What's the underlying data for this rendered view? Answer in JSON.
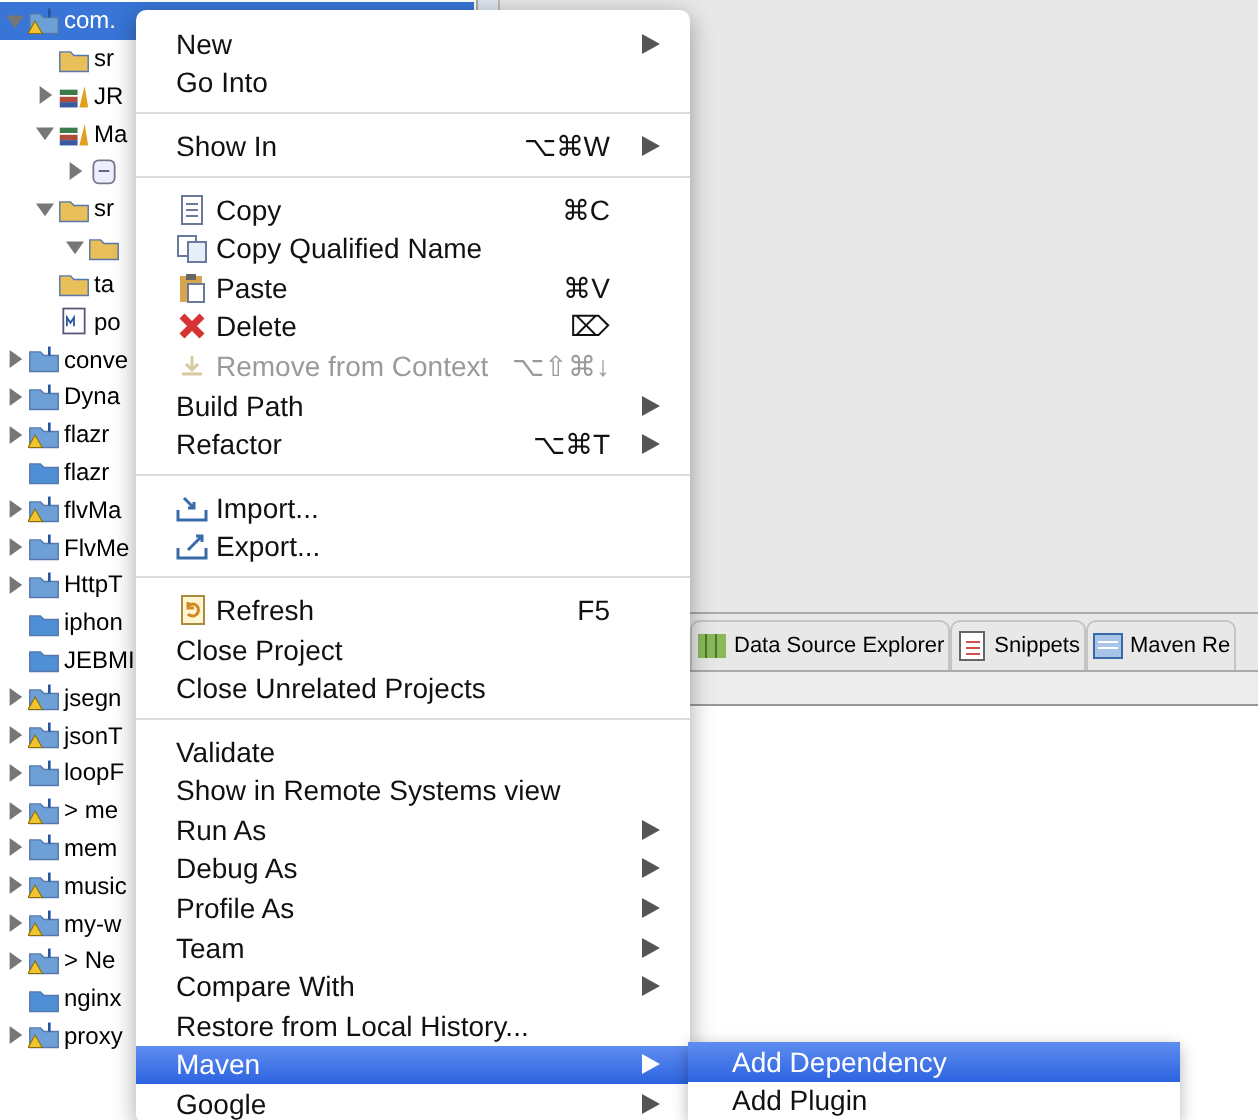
{
  "tree": [
    {
      "label": "com.",
      "kind": "maven-project",
      "warning": true,
      "expanded": true,
      "selected": true,
      "children": [
        {
          "label": "sr",
          "kind": "package-folder"
        },
        {
          "label": "JR",
          "kind": "library",
          "expanded": false
        },
        {
          "label": "Ma",
          "kind": "library",
          "expanded": true,
          "children": [
            {
              "kind": "jar",
              "expanded": false
            }
          ]
        },
        {
          "label": "sr",
          "kind": "folder",
          "expanded": true,
          "children": [
            {
              "kind": "folder",
              "expanded": true
            }
          ]
        },
        {
          "label": "ta",
          "kind": "folder"
        },
        {
          "label": "po",
          "kind": "pom"
        }
      ]
    },
    {
      "label": "conve",
      "kind": "project",
      "expanded": false
    },
    {
      "label": "Dyna",
      "kind": "web-project",
      "expanded": false
    },
    {
      "label": "flazr",
      "kind": "project",
      "warning": true,
      "expanded": false
    },
    {
      "label": "flazr",
      "kind": "closed-project"
    },
    {
      "label": "flvMa",
      "kind": "project",
      "warning": true,
      "expanded": false
    },
    {
      "label": "FlvMe",
      "kind": "project",
      "expanded": false
    },
    {
      "label": "HttpT",
      "kind": "project",
      "expanded": false
    },
    {
      "label": "iphon",
      "kind": "closed-project"
    },
    {
      "label": "JEBMI",
      "kind": "closed-project"
    },
    {
      "label": "jsegn",
      "kind": "project",
      "warning": true,
      "expanded": false
    },
    {
      "label": "jsonT",
      "kind": "project",
      "warning": true,
      "expanded": false
    },
    {
      "label": "loopF",
      "kind": "project",
      "expanded": false
    },
    {
      "label": "> me",
      "kind": "project",
      "warning": true,
      "expanded": false
    },
    {
      "label": "mem",
      "kind": "project",
      "expanded": false
    },
    {
      "label": "music",
      "kind": "project",
      "warning": true,
      "expanded": false
    },
    {
      "label": "my-w",
      "kind": "maven-project",
      "warning": true,
      "expanded": false
    },
    {
      "label": "> Ne",
      "kind": "project",
      "warning": true,
      "expanded": false
    },
    {
      "label": "nginx",
      "kind": "closed-project"
    },
    {
      "label": "proxy",
      "kind": "project",
      "warning": true,
      "expanded": false
    }
  ],
  "tabs": [
    {
      "label": "Data Source Explorer",
      "kind": "map",
      "selected": false
    },
    {
      "label": "Snippets",
      "kind": "snippets",
      "selected": false
    },
    {
      "label": "Maven Re",
      "kind": "maven-repo",
      "selected": false
    }
  ],
  "menu": [
    {
      "kind": "item",
      "label": "New",
      "submenu": true
    },
    {
      "kind": "item",
      "label": "Go Into"
    },
    {
      "kind": "separator"
    },
    {
      "kind": "item",
      "label": "Show In",
      "shortcut": "⌥⌘W",
      "submenu": true
    },
    {
      "kind": "separator"
    },
    {
      "kind": "copy",
      "label": "Copy",
      "shortcut": "⌘C"
    },
    {
      "kind": "copy-qualified",
      "label": "Copy Qualified Name"
    },
    {
      "kind": "paste",
      "label": "Paste",
      "shortcut": "⌘V"
    },
    {
      "kind": "delete",
      "label": "Delete",
      "shortcut": "⌦"
    },
    {
      "kind": "remove",
      "label": "Remove from Context",
      "shortcut": "⌥⇧⌘↓",
      "disabled": true
    },
    {
      "kind": "item",
      "label": "Build Path",
      "submenu": true
    },
    {
      "kind": "item",
      "label": "Refactor",
      "shortcut": "⌥⌘T",
      "submenu": true
    },
    {
      "kind": "separator"
    },
    {
      "kind": "import",
      "label": "Import..."
    },
    {
      "kind": "export",
      "label": "Export..."
    },
    {
      "kind": "separator"
    },
    {
      "kind": "refresh",
      "label": "Refresh",
      "shortcut": "F5"
    },
    {
      "kind": "item",
      "label": "Close Project"
    },
    {
      "kind": "item",
      "label": "Close Unrelated Projects"
    },
    {
      "kind": "separator"
    },
    {
      "kind": "item",
      "label": "Validate"
    },
    {
      "kind": "item",
      "label": "Show in Remote Systems view"
    },
    {
      "kind": "item",
      "label": "Run As",
      "submenu": true
    },
    {
      "kind": "item",
      "label": "Debug As",
      "submenu": true
    },
    {
      "kind": "item",
      "label": "Profile As",
      "submenu": true
    },
    {
      "kind": "item",
      "label": "Team",
      "submenu": true
    },
    {
      "kind": "item",
      "label": "Compare With",
      "submenu": true
    },
    {
      "kind": "item",
      "label": "Restore from Local History..."
    },
    {
      "kind": "item",
      "label": "Maven",
      "submenu": true,
      "selected": true,
      "children": [
        {
          "label": "Add Dependency",
          "selected": true
        },
        {
          "label": "Add Plugin",
          "selected": false
        }
      ]
    },
    {
      "kind": "item",
      "label": "Google",
      "submenu": true
    }
  ]
}
